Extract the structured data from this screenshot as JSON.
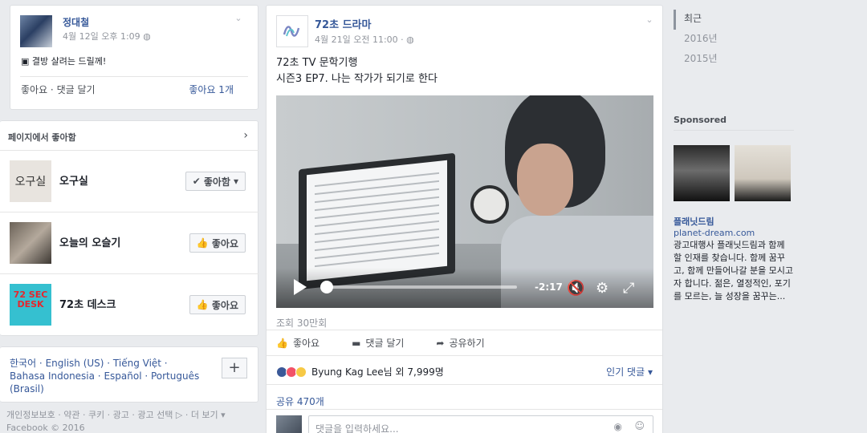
{
  "left_post": {
    "author": "정대철",
    "time": "4월 12일 오후 1:09",
    "status": "결방 살려는 드릴께!",
    "actions": "좋아요 · 댓글 달기",
    "like_count": "좋아요 1개"
  },
  "pages_liked": {
    "header": "페이지에서 좋아함",
    "items": [
      {
        "name": "오구실",
        "thumb_text": "오구실",
        "button": "좋아함",
        "liked": true
      },
      {
        "name": "오늘의 오슬기",
        "thumb_text": "",
        "button": "좋아요",
        "liked": false
      },
      {
        "name": "72초 데스크",
        "thumb_text": "72 SEC DESK",
        "button": "좋아요",
        "liked": false
      }
    ]
  },
  "languages": {
    "text": "한국어 · English (US) · Tiếng Việt · Bahasa Indonesia · Español · Português (Brasil)",
    "add_label": "+"
  },
  "footer": {
    "links": "개인정보보호 · 약관 · 쿠키 · 광고 · 광고 선택 ▷ · 더 보기 ▾",
    "copyright": "Facebook © 2016"
  },
  "main_post": {
    "author": "72초 드라마",
    "time": "4월 21일 오전 11:00 ·",
    "line1": "72초 TV 문학기행",
    "line2": "시즌3 EP7. 나는 작가가 되기로 한다",
    "video_time": "-2:17",
    "views": "조회 30만회",
    "actions": {
      "like": "좋아요",
      "comment": "댓글 달기",
      "share": "공유하기"
    },
    "reactions": "Byung Kag Lee님 외 7,999명",
    "sort": "인기 댓글",
    "shares": "공유 470개",
    "comment_placeholder": "댓글을 입력하세요..."
  },
  "years": [
    {
      "label": "최근",
      "active": true
    },
    {
      "label": "2016년",
      "active": false
    },
    {
      "label": "2015년",
      "active": false
    }
  ],
  "sponsored": {
    "title": "Sponsored",
    "ad_name": "플래닛드림",
    "ad_url": "planet-dream.com",
    "ad_desc": "광고대행사 플래닛드림과 함께 할 인재를 찾습니다. 함께 꿈꾸고, 함께 만들어나갈 분을 모시고자 합니다. 젊은, 열정적인, 포기를 모르는, 늘 성장을 꿈꾸는..."
  },
  "colors": {
    "link": "#365899",
    "background": "#e9ebee",
    "like_reaction": "#3b5998",
    "love_reaction": "#f25268",
    "haha_reaction": "#f7c945"
  }
}
